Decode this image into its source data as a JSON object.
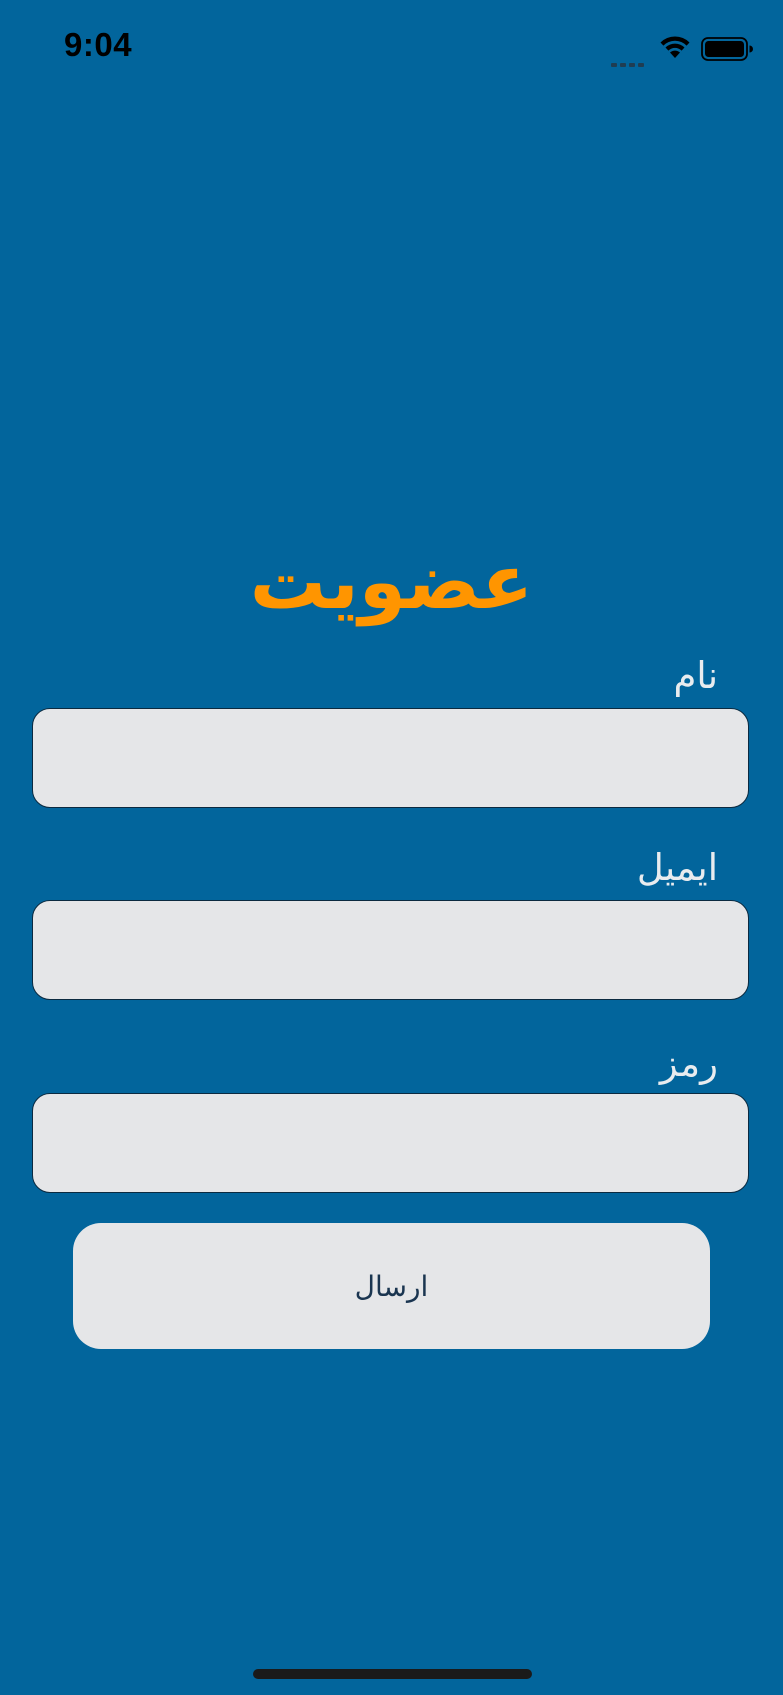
{
  "status_bar": {
    "time": "9:04",
    "icons": [
      "cellular-signal-icon",
      "wifi-icon",
      "battery-icon"
    ]
  },
  "form": {
    "title": "عضویت",
    "fields": [
      {
        "label": "نام",
        "value": "",
        "placeholder": ""
      },
      {
        "label": "ایمیل",
        "value": "",
        "placeholder": ""
      },
      {
        "label": "رمز",
        "value": "",
        "placeholder": ""
      }
    ],
    "submit_label": "ارسال"
  },
  "colors": {
    "background": "#02659c",
    "title": "#ff9500",
    "label": "#e9ecef",
    "field_background": "#e5e6e8",
    "button_text": "#1a3550"
  }
}
